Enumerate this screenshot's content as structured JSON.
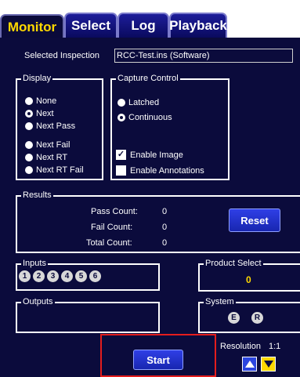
{
  "tabs": [
    {
      "label": "Monitor",
      "active": true
    },
    {
      "label": "Select",
      "active": false
    },
    {
      "label": "Log",
      "active": false
    },
    {
      "label": "Playback",
      "active": false
    }
  ],
  "selected_inspection": {
    "label": "Selected Inspection",
    "value": "RCC-Test.ins (Software)"
  },
  "display": {
    "title": "Display",
    "options": [
      {
        "label": "None",
        "selected": false
      },
      {
        "label": "Next",
        "selected": true
      },
      {
        "label": "Next Pass",
        "selected": false
      },
      {
        "label": "Next Fail",
        "selected": false
      },
      {
        "label": "Next RT",
        "selected": false
      },
      {
        "label": "Next RT Fail",
        "selected": false
      }
    ]
  },
  "capture_control": {
    "title": "Capture Control",
    "modes": [
      {
        "label": "Latched",
        "selected": false
      },
      {
        "label": "Continuous",
        "selected": true
      }
    ],
    "enable_image": {
      "label": "Enable Image",
      "checked": true
    },
    "enable_annotations": {
      "label": "Enable Annotations",
      "checked": false
    }
  },
  "results": {
    "title": "Results",
    "pass_label": "Pass Count:",
    "pass_value": "0",
    "fail_label": "Fail Count:",
    "fail_value": "0",
    "total_label": "Total Count:",
    "total_value": "0",
    "reset_label": "Reset"
  },
  "inputs": {
    "title": "Inputs",
    "items": [
      "1",
      "2",
      "3",
      "4",
      "5",
      "6"
    ]
  },
  "product_select": {
    "title": "Product Select",
    "value": "0"
  },
  "outputs": {
    "title": "Outputs"
  },
  "system": {
    "title": "System",
    "badges": [
      "E",
      "R"
    ]
  },
  "start_label": "Start",
  "resolution": {
    "label": "Resolution",
    "value": "1:1"
  },
  "colors": {
    "panel": "#0b0b3c",
    "tab": "#1d1d9a",
    "active_tab_text": "#ffd800",
    "button": "#2436d6",
    "highlight": "#e41d1d"
  }
}
